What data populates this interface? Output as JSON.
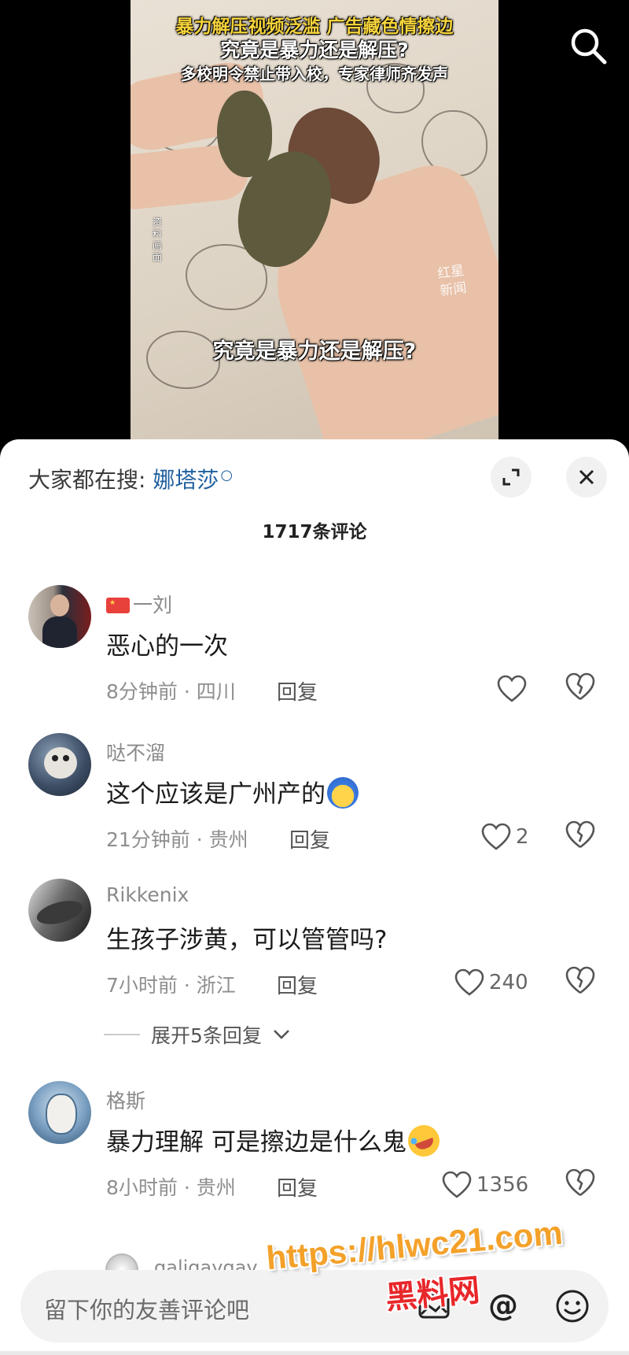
{
  "video": {
    "headline_line1": "暴力解压视频泛滥 广告藏色情擦边",
    "headline_line2": "究竟是暴力还是解压?",
    "headline_line3": "多校明令禁止带入校，专家律师齐发声",
    "caption": "究竟是暴力还是解压?",
    "side_note": "资料画面",
    "watermark_line1": "红星",
    "watermark_line2": "新闻"
  },
  "sheet": {
    "search_prefix": "大家都在搜:",
    "search_keyword": "娜塔莎",
    "comment_count": "1717条评论",
    "expand_replies": "展开5条回复"
  },
  "comments": [
    {
      "user": "一刘",
      "text": "恶心的一次",
      "time": "8分钟前",
      "location": "四川",
      "reply": "回复",
      "likes": ""
    },
    {
      "user": "哒不溜",
      "text": "这个应该是广州产的",
      "time": "21分钟前",
      "location": "贵州",
      "reply": "回复",
      "likes": "2"
    },
    {
      "user": "Rikkenix",
      "text": "生孩子涉黄，可以管管吗?",
      "time": "7小时前",
      "location": "浙江",
      "reply": "回复",
      "likes": "240"
    },
    {
      "user": "格斯",
      "text": "暴力理解 可是擦边是什么鬼",
      "time": "8小时前",
      "location": "贵州",
      "reply": "回复",
      "likes": "1356"
    }
  ],
  "partial_comment": {
    "user": "galigaygay"
  },
  "input": {
    "placeholder": "留下你的友善评论吧"
  },
  "overlay": {
    "url": "https://hlwc21.com",
    "name": "黑料网"
  },
  "colors": {
    "keyword": "#1f5f9e",
    "overlay_url": "#f4a12a",
    "overlay_name": "#e8272b"
  }
}
